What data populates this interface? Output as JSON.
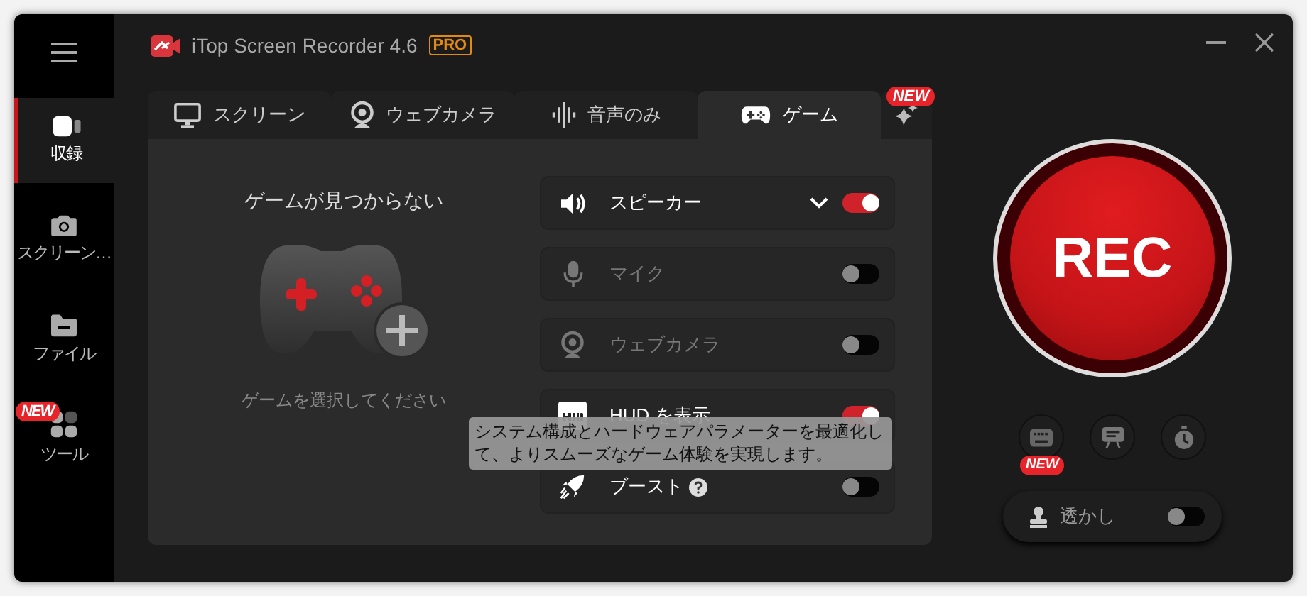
{
  "title_bar": {
    "title": "iTop Screen Recorder 4.6",
    "badge": "PRO"
  },
  "sidebar": {
    "items": [
      {
        "label": "収録",
        "selected": true
      },
      {
        "label": "スクリーン…",
        "selected": false
      },
      {
        "label": "ファイル",
        "selected": false
      },
      {
        "label": "ツール",
        "selected": false,
        "badge": "NEW"
      }
    ]
  },
  "tabs": [
    {
      "label": "スクリーン",
      "selected": false
    },
    {
      "label": "ウェブカメラ",
      "selected": false
    },
    {
      "label": "音声のみ",
      "selected": false
    },
    {
      "label": "ゲーム",
      "selected": true
    },
    {
      "selected": false,
      "badge": "NEW"
    }
  ],
  "game": {
    "title": "ゲームが見つからない",
    "caption": "ゲームを選択してください"
  },
  "sources": [
    {
      "kind": "select",
      "label": "スピーカー",
      "on": true,
      "disabled": false
    },
    {
      "kind": "toggle",
      "label": "マイク",
      "on": false,
      "disabled": true
    },
    {
      "kind": "toggle",
      "label": "ウェブカメラ",
      "on": false,
      "disabled": true
    },
    {
      "kind": "toggle",
      "label": "HUD を表示",
      "on": true,
      "disabled": false
    },
    {
      "kind": "help",
      "label": "ブースト",
      "on": false,
      "disabled": false
    }
  ],
  "tooltip": "システム構成とハードウェアパラメーターを最適化して、よりスムーズなゲーム体験を実現します。",
  "record": {
    "label": "REC"
  },
  "tools_badge": "NEW",
  "watermark": {
    "label": "透かし",
    "on": false
  }
}
